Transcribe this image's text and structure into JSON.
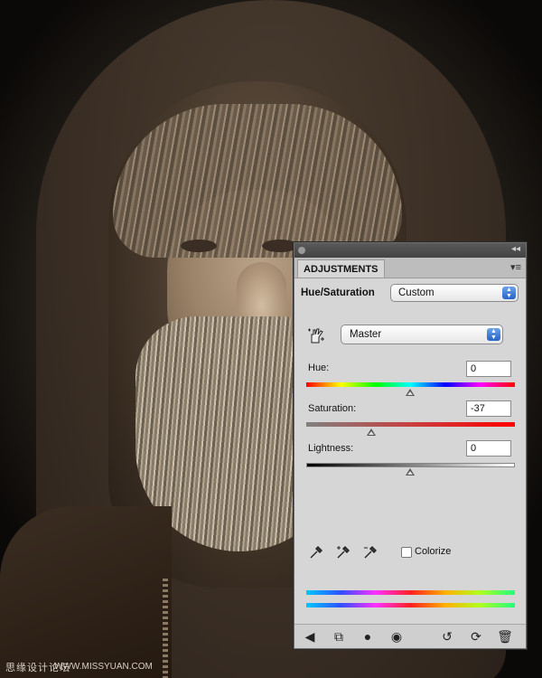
{
  "panel": {
    "tab_label": "ADJUSTMENTS",
    "adjustment_title": "Hue/Saturation",
    "preset_value": "Custom",
    "channel_value": "Master",
    "hue": {
      "label": "Hue:",
      "value": "0",
      "level_fraction": 0.5
    },
    "saturation": {
      "label": "Saturation:",
      "value": "-37",
      "level_fraction": 0.315
    },
    "lightness": {
      "label": "Lightness:",
      "value": "0",
      "level_fraction": 0.5
    },
    "colorize_label": "Colorize",
    "colorize_checked": false
  },
  "watermark": {
    "left_text": "思缘设计论坛",
    "right_text": "WWW.MISSYUAN.COM"
  },
  "icons": {
    "panel_menu": "menu-icon",
    "collapse": "collapse-icon",
    "hand": "targeted-adjustment-icon",
    "eyedroppers": [
      "eyedropper-icon",
      "eyedropper-add-icon",
      "eyedropper-subtract-icon"
    ],
    "bottom": [
      "back-arrow-icon",
      "clip-to-layer-icon",
      "layer-mask-icon",
      "visibility-eye-icon",
      "previous-state-icon",
      "reset-icon",
      "trash-icon"
    ]
  }
}
